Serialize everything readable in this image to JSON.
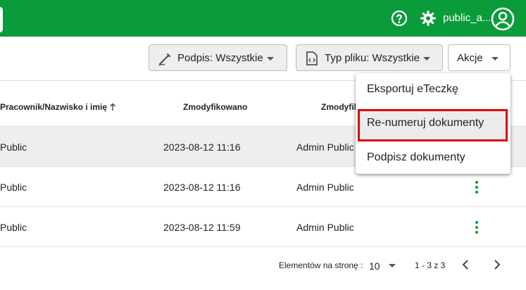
{
  "header": {
    "user_name": "public_a...",
    "icons": [
      "help-icon",
      "gear-icon",
      "account-icon"
    ],
    "bg_color": "#0a9c3a"
  },
  "toolbar": {
    "signature_filter": "Podpis: Wszystkie",
    "filetype_filter": "Typ pliku: Wszystkie",
    "actions_label": "Akcje"
  },
  "table": {
    "columns": [
      "Pracownik/Nazwisko i imię",
      "Zmodyfikowano",
      "Zmodyfik"
    ],
    "rows": [
      {
        "employee": "Public",
        "modified": "2023-08-12 11:16",
        "modified_by": "Admin Public"
      },
      {
        "employee": "Public",
        "modified": "2023-08-12 11:16",
        "modified_by": "Admin Public"
      },
      {
        "employee": "Public",
        "modified": "2023-08-12 11:59",
        "modified_by": "Admin Public"
      }
    ]
  },
  "pagination": {
    "items_per_page_label": "Elementów na stronę :",
    "page_size": "10",
    "range": "1 - 3 z 3"
  },
  "actions_menu": {
    "items": [
      "Eksportuj eTeczkę",
      "Re-numeruj dokumenty",
      "Podpisz dokumenty"
    ],
    "highlighted_item": "Re-numeruj dokumenty",
    "highlight_color": "#e00000"
  }
}
